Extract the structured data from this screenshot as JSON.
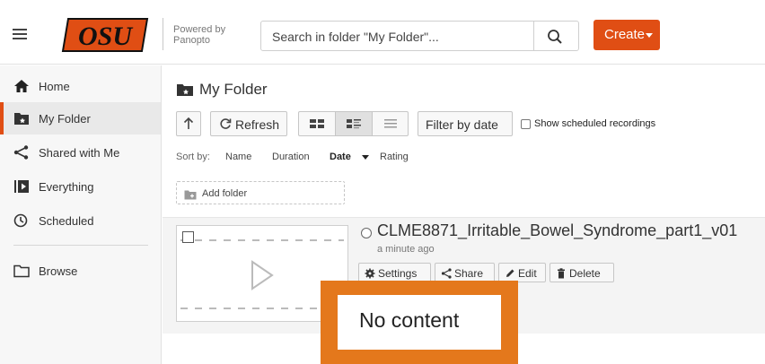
{
  "header": {
    "logo_alt": "OSU",
    "powered_line1": "Powered by",
    "powered_line2": "Panopto",
    "search_placeholder": "Search in folder \"My Folder\"...",
    "create_label": "Create",
    "brand_color": "#e04e14"
  },
  "sidebar": {
    "items": [
      {
        "label": "Home",
        "icon": "home-icon"
      },
      {
        "label": "My Folder",
        "icon": "folder-user-icon",
        "active": true
      },
      {
        "label": "Shared with Me",
        "icon": "share-icon"
      },
      {
        "label": "Everything",
        "icon": "video-library-icon"
      },
      {
        "label": "Scheduled",
        "icon": "clock-icon"
      },
      {
        "label": "Browse",
        "icon": "folder-icon"
      }
    ]
  },
  "main": {
    "title": "My Folder",
    "toolbar": {
      "refresh_label": "Refresh",
      "filter_label": "Filter by date",
      "show_scheduled_label": "Show scheduled recordings"
    },
    "sort": {
      "label": "Sort by:",
      "options": [
        "Name",
        "Duration",
        "Date",
        "Rating"
      ],
      "active": "Date"
    },
    "add_folder_label": "Add folder",
    "session": {
      "title": "CLME8871_Irritable_Bowel_Syndrome_part1_v01",
      "time": "a minute ago",
      "actions": [
        "Settings",
        "Share",
        "Edit",
        "Delete"
      ]
    }
  },
  "overlay": {
    "text": "No content",
    "color": "#e4781c"
  }
}
